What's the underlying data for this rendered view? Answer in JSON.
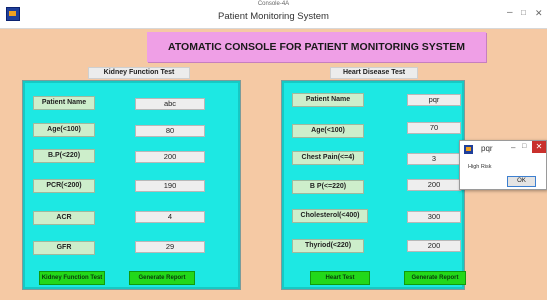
{
  "window": {
    "superscript": "Console-4A",
    "title": "Patient Monitoring System",
    "minimize_glyph": "–",
    "maximize_glyph": "□",
    "close_glyph": "✕"
  },
  "banner": {
    "text": "ATOMATIC CONSOLE FOR PATIENT MONITORING SYSTEM"
  },
  "kidney": {
    "section_title": "Kidney Function Test",
    "rows": [
      {
        "label": "Patient Name",
        "value": "abc"
      },
      {
        "label": "Age(<100)",
        "value": "80"
      },
      {
        "label": "B.P(<220)",
        "value": "200"
      },
      {
        "label": "PCR(<200)",
        "value": "190"
      },
      {
        "label": "ACR",
        "value": "4"
      },
      {
        "label": "GFR",
        "value": "29"
      }
    ],
    "test_button": "Kidney Function Test",
    "report_button": "Generate Report"
  },
  "heart": {
    "section_title": "Heart Disease Test",
    "rows": [
      {
        "label": "Patient Name",
        "value": "pqr"
      },
      {
        "label": "Age(<100)",
        "value": "70"
      },
      {
        "label": "Chest Pain(<=4)",
        "value": "3"
      },
      {
        "label": "B P(<=220)",
        "value": "200"
      },
      {
        "label": "Cholesterol(<400)",
        "value": "300"
      },
      {
        "label": "Thyriod(<220)",
        "value": "200"
      }
    ],
    "test_button": "Heart Test",
    "report_button": "Generate Report"
  },
  "dialog": {
    "title": "pqr",
    "message": "High Risk",
    "ok_label": "OK",
    "minimize_glyph": "–",
    "maximize_glyph": "□",
    "close_glyph": "✕"
  }
}
